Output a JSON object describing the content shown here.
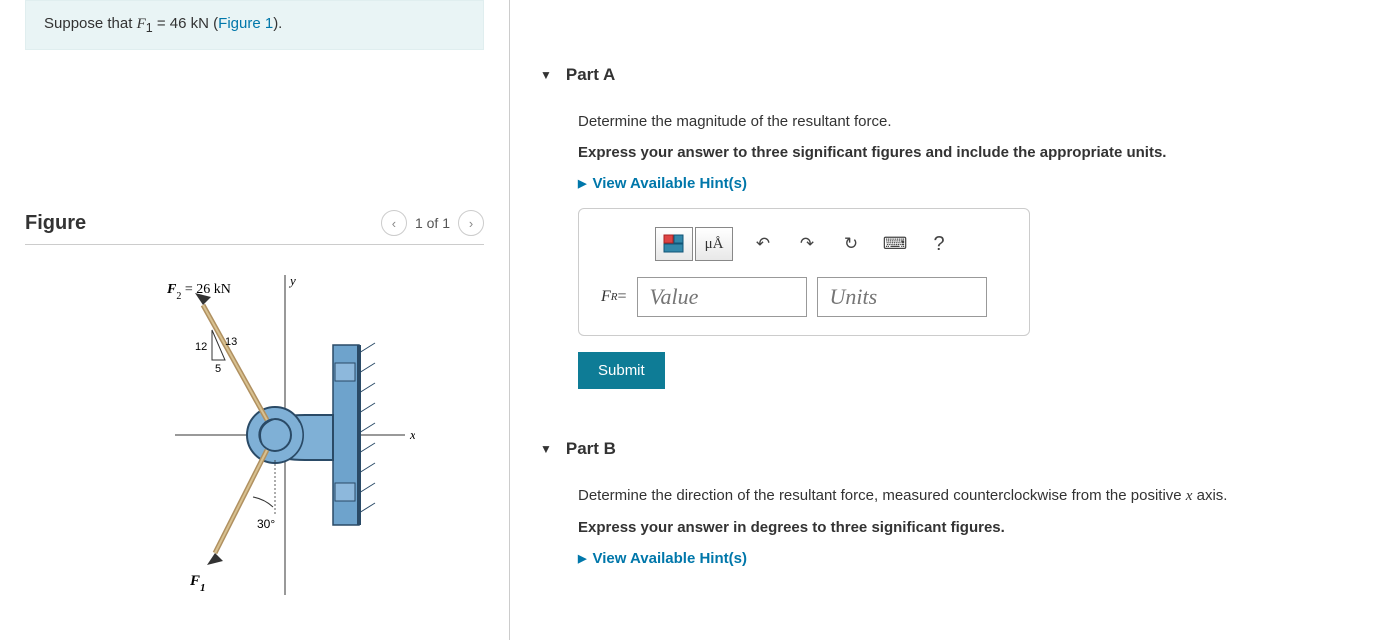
{
  "instruction": {
    "prefix": "Suppose that ",
    "variable": "F",
    "subscript": "1",
    "equals": " = 46 kN (",
    "figure_link": "Figure 1",
    "suffix": ")."
  },
  "figure": {
    "title": "Figure",
    "nav_text": "1 of 1",
    "labels": {
      "f2": "F",
      "f2_sub": "2",
      "f2_value": " = 26 kN",
      "f1": "F",
      "f1_sub": "1",
      "y": "y",
      "x": "x",
      "tri_12": "12",
      "tri_13": "13",
      "tri_5": "5",
      "angle": "30°"
    }
  },
  "partA": {
    "title": "Part A",
    "desc1": "Determine the magnitude of the resultant force.",
    "desc2": "Express your answer to three significant figures and include the appropriate units.",
    "hint_label": "View Available Hint(s)",
    "fr_label_main": "F",
    "fr_label_sub": "R",
    "fr_equals": " = ",
    "value_placeholder": "Value",
    "units_placeholder": "Units",
    "submit_label": "Submit",
    "toolbar": {
      "templates": "⬚",
      "units": "μÅ",
      "undo": "↶",
      "redo": "↷",
      "reset": "↻",
      "keyboard": "⌨",
      "help": "?"
    }
  },
  "partB": {
    "title": "Part B",
    "desc1_pre": "Determine the direction of the resultant force, measured counterclockwise from the positive ",
    "desc1_var": "x",
    "desc1_post": " axis.",
    "desc2": "Express your answer in degrees to three significant figures.",
    "hint_label": "View Available Hint(s)"
  }
}
